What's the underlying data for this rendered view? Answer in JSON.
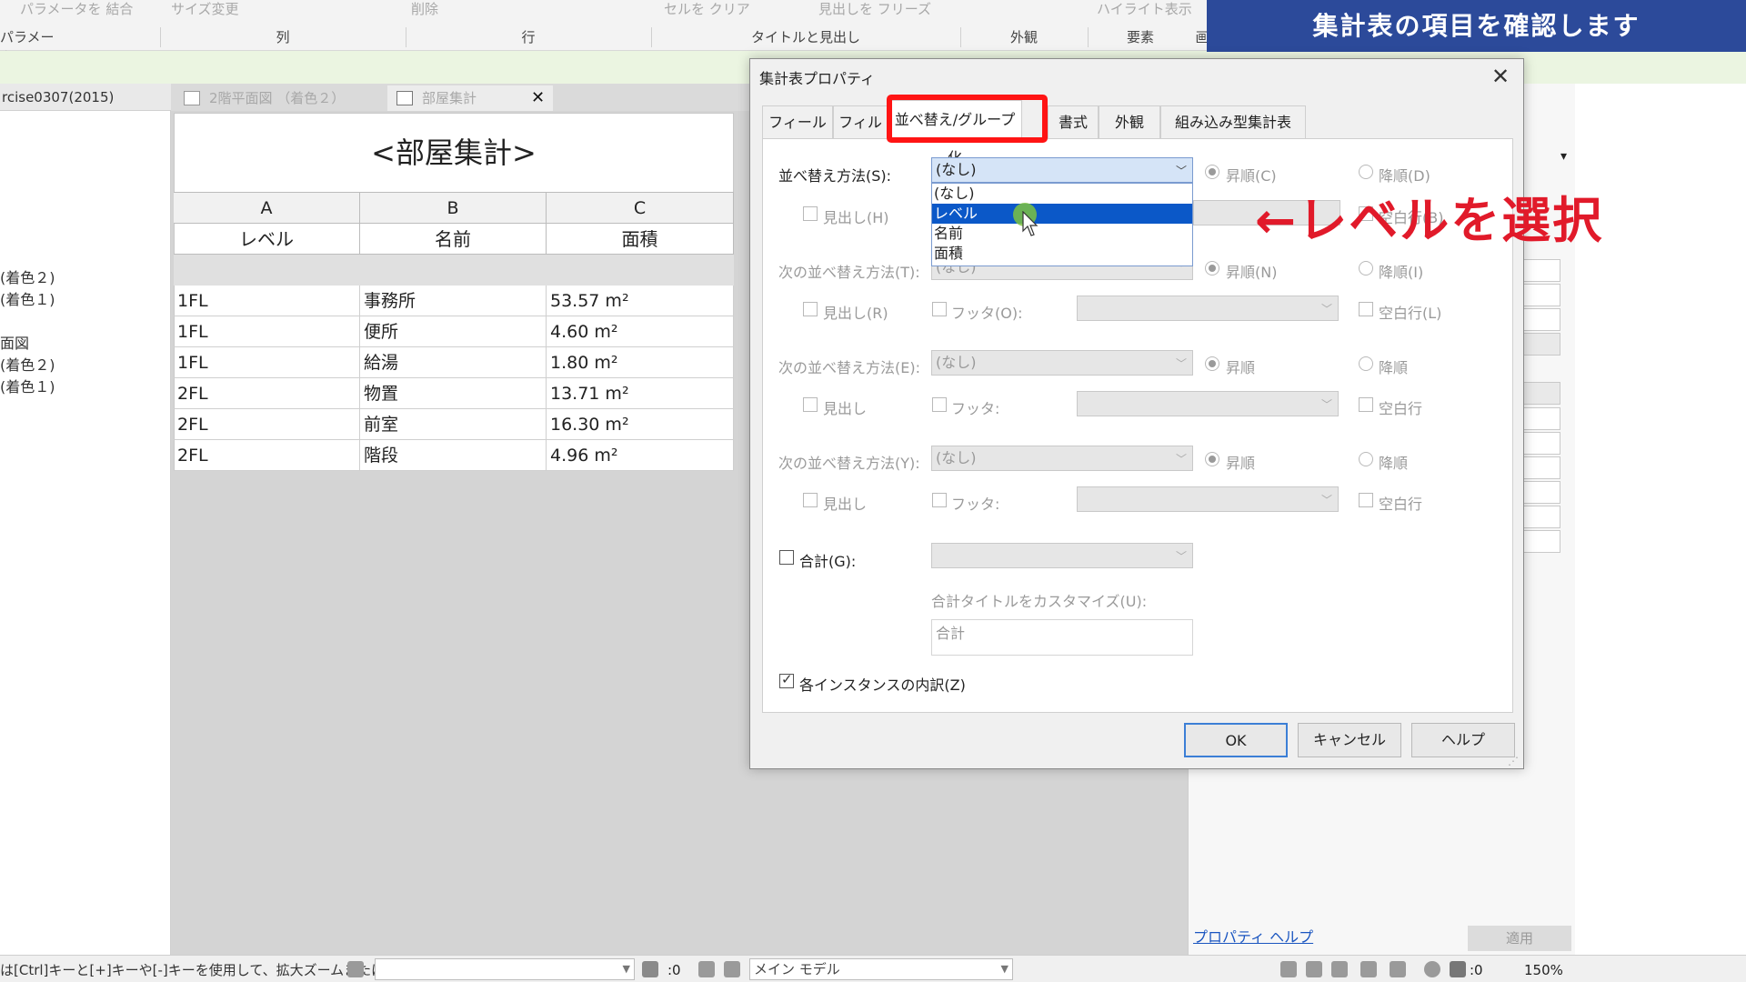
{
  "banner": {
    "text": "集計表の項目を確認します"
  },
  "ribbon": {
    "tools": [
      "パラメータを 結合",
      "サイズ変更",
      "削除",
      "セルを クリア",
      "見出しを フリーズ",
      "ハイライト表示"
    ],
    "panels": [
      "パラメータ",
      "列",
      "行",
      "タイトルと見出し",
      "外観",
      "要素",
      "画"
    ]
  },
  "browser": {
    "header": "rcise0307(2015)",
    "items": [
      "(着色２)",
      "(着色１)",
      "面図",
      "(着色２)",
      "(着色１)"
    ]
  },
  "doc_tabs": {
    "tab1": "2階平面図 （着色２）",
    "tab2": "部屋集計",
    "close": "✕"
  },
  "schedule": {
    "title": "<部屋集計>",
    "col_letters": [
      "A",
      "B",
      "C"
    ],
    "col_names": [
      "レベル",
      "名前",
      "面積"
    ],
    "rows": [
      [
        "1FL",
        "事務所",
        "53.57 m²"
      ],
      [
        "1FL",
        "便所",
        "4.60 m²"
      ],
      [
        "1FL",
        "給湯",
        "1.80 m²"
      ],
      [
        "2FL",
        "物置",
        "13.71 m²"
      ],
      [
        "2FL",
        "前室",
        "16.30 m²"
      ],
      [
        "2FL",
        "階段",
        "4.96 m²"
      ]
    ]
  },
  "properties": {
    "help_link": "プロパティ ヘルプ",
    "apply": "適用",
    "arrow": "▾"
  },
  "status": {
    "hint": "は[Ctrl]キーと[+]キーや[-]キーを使用して、拡大ズームまたは",
    "count": ":0",
    "model": "メイン モデル",
    "filter_count": ":0",
    "zoom": "150%"
  },
  "dialog": {
    "title": "集計表プロパティ",
    "close": "✕",
    "tabs": [
      "フィールド",
      "フィルタ",
      "並べ替え/グループ化",
      "書式",
      "外観",
      "組み込み型集計表"
    ],
    "sort_by_label": "並べ替え方法(S):",
    "sort_by_value": "(なし)",
    "dropdown_options": [
      "(なし)",
      "レベル",
      "名前",
      "面積"
    ],
    "asc_c": "昇順(C)",
    "desc_d": "降順(D)",
    "header_h": "見出し(H)",
    "blank_row_b": "空白行(B)",
    "then_by_t": "次の並べ替え方法(T):",
    "then_by_t_value": "(なし)",
    "asc_n": "昇順(N)",
    "desc_i": "降順(I)",
    "header_r": "見出し(R)",
    "footer_o": "フッタ(O):",
    "blank_row_l": "空白行(L)",
    "then_by_e": "次の並べ替え方法(E):",
    "then_by_e_value": "(なし)",
    "asc": "昇順",
    "desc": "降順",
    "header": "見出し",
    "footer": "フッタ:",
    "blank_row": "空白行",
    "then_by_y": "次の並べ替え方法(Y):",
    "then_by_y_value": "(なし)",
    "total_g": "合計(G):",
    "customize_total_title": "合計タイトルをカスタマイズ(U):",
    "total_title_value": "合計",
    "itemize": "各インスタンスの内訳(Z)",
    "ok": "OK",
    "cancel": "キャンセル",
    "help": "ヘルプ"
  },
  "annotation": {
    "text": "←レベルを選択",
    "color": "#e11a2a"
  },
  "colors": {
    "banner_bg": "#2c4a9a",
    "highlight": "#ff1414",
    "selection": "#0b58c8"
  }
}
